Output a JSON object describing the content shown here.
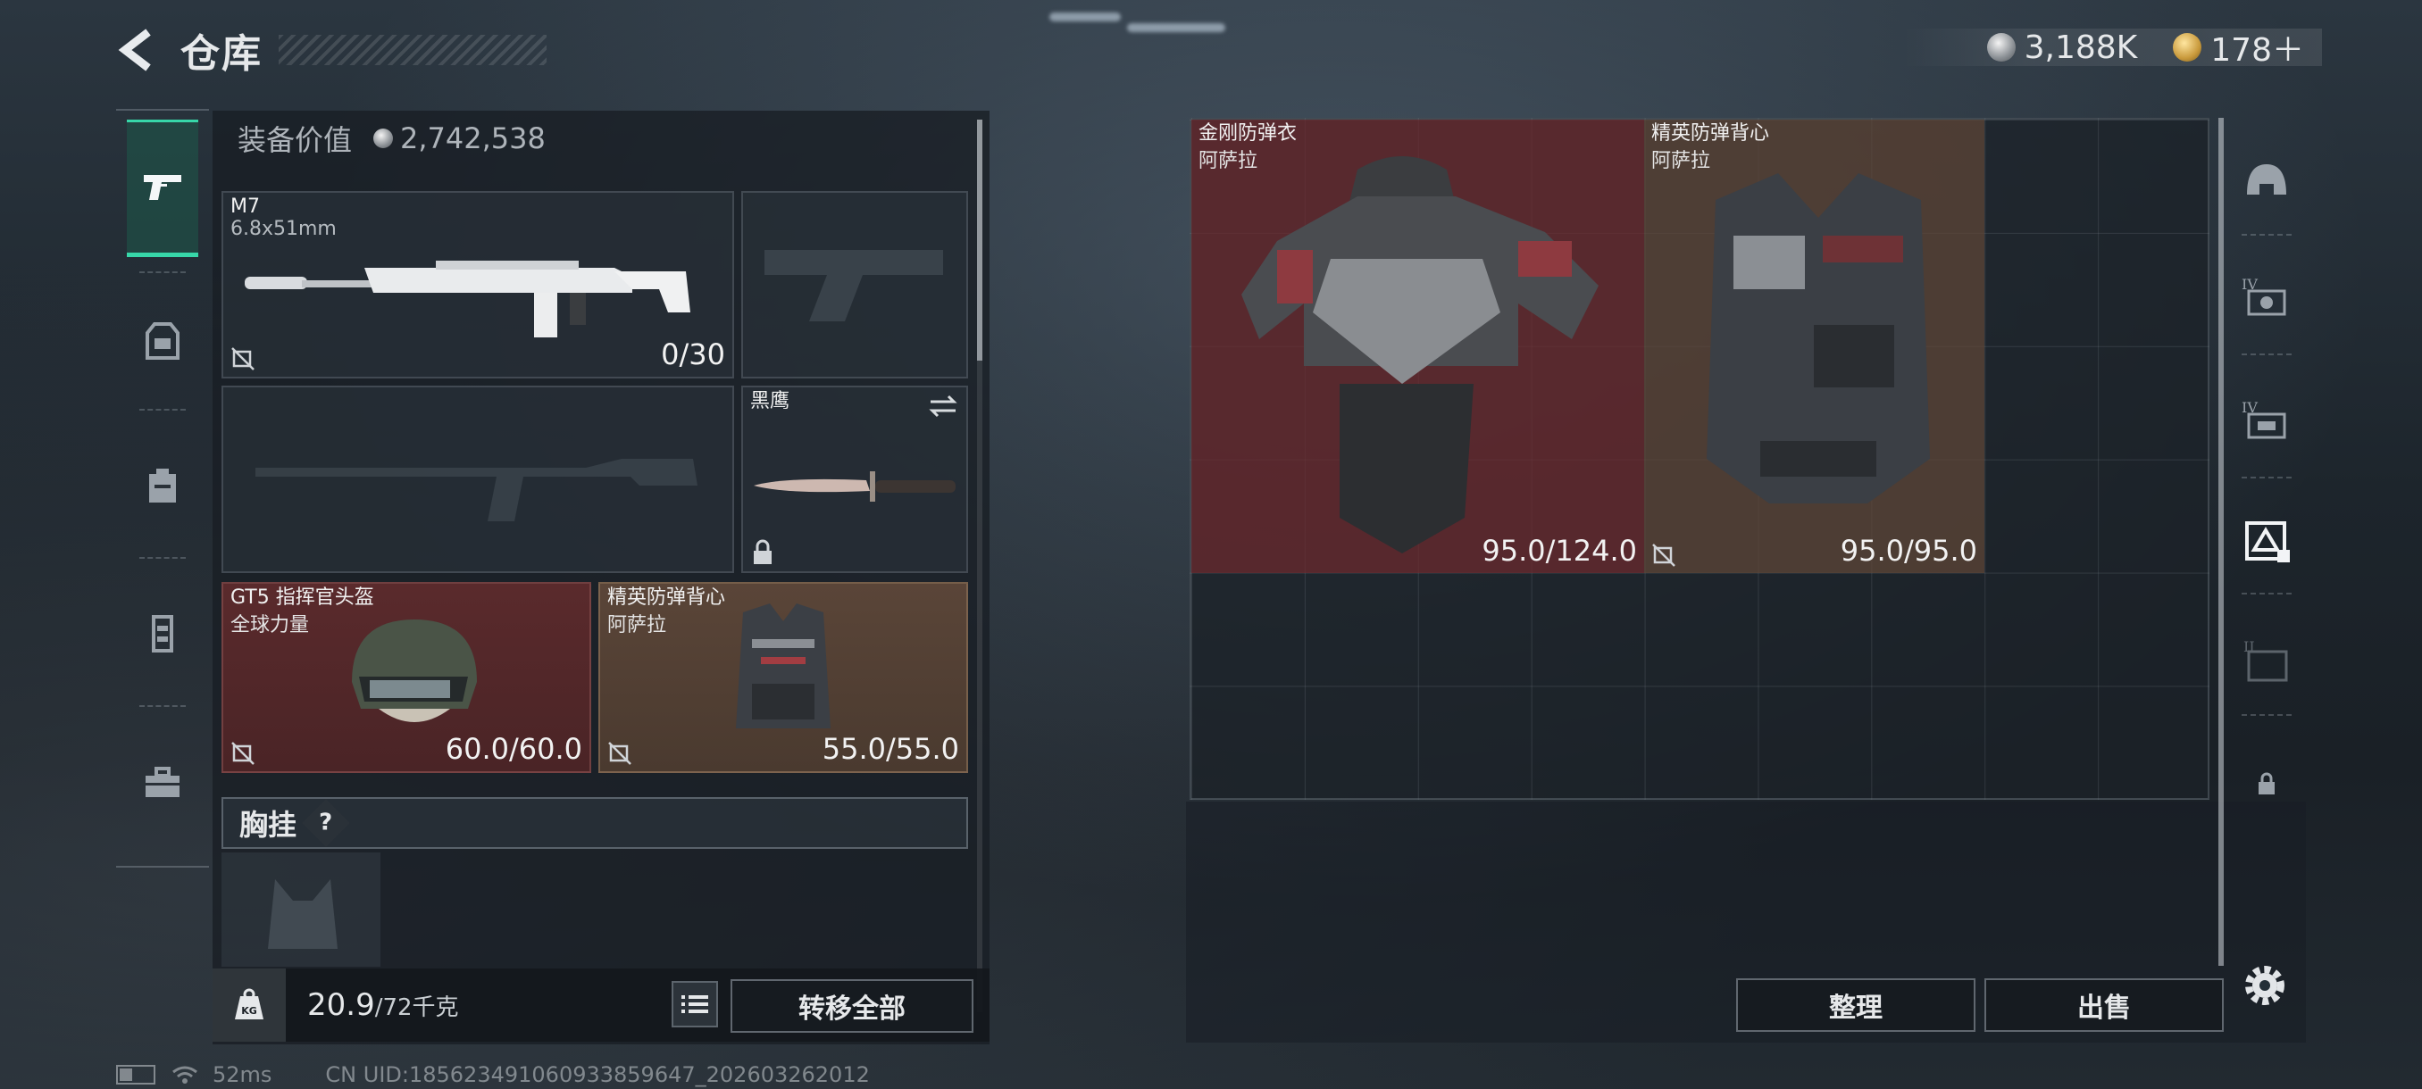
{
  "header": {
    "title": "仓库",
    "currency": [
      {
        "icon": "silver-coin-icon",
        "value": "3,188K"
      },
      {
        "icon": "gold-coin-icon",
        "value": "178＋"
      }
    ]
  },
  "rail": {
    "items": [
      "pistol-icon",
      "backpack-armor-icon",
      "backpack-icon",
      "chest-rig-icon",
      "toolbox-icon"
    ],
    "active": "pistol-icon"
  },
  "left_panel": {
    "equip_value_label": "装备价值",
    "equip_value": "2,742,538",
    "primary_weapon": {
      "name": "M7",
      "caliber": "6.8x51mm",
      "ammo": "0/30"
    },
    "knife": {
      "name": "黑鹰"
    },
    "helmet": {
      "name": "GT5 指挥官头盔",
      "brand": "全球力量",
      "durability": "60.0/60.0"
    },
    "armor": {
      "name": "精英防弹背心",
      "brand": "阿萨拉",
      "durability": "55.0/55.0"
    },
    "chest_label": "胸挂",
    "help": "?",
    "weight": "20.9",
    "weight_max": "/72千克",
    "kg_label": "KG",
    "transfer_all": "转移全部"
  },
  "storage": {
    "items": [
      {
        "name": "金刚防弹衣",
        "brand": "阿萨拉",
        "durability": "95.0/124.0",
        "rarity_color": "#6e2a2e"
      },
      {
        "name": "精英防弹背心",
        "brand": "阿萨拉",
        "durability": "95.0/95.0",
        "rarity_color": "#604637"
      }
    ],
    "sort_button": "整理",
    "sell_button": "出售",
    "side_tabs": [
      "helmet-tab-icon",
      "armor-iv-icon",
      "armor-iv-icon-2",
      "armor-selected-icon",
      "armor-ii-icon",
      "lock-icon"
    ]
  },
  "status": {
    "ping": "52ms",
    "uid": "CN UID:1856234910609338596​47_202603262012"
  }
}
